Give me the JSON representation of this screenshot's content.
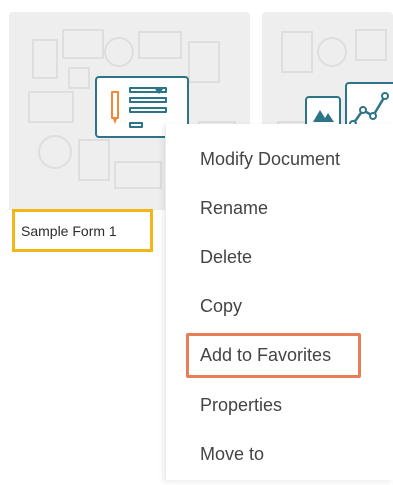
{
  "cards": [
    {
      "name": "Sample Form 1"
    }
  ],
  "context_menu": {
    "items": [
      "Modify Document",
      "Rename",
      "Delete",
      "Copy",
      "Add to Favorites",
      "Properties",
      "Move to"
    ],
    "highlighted_item": "Add to Favorites"
  },
  "colors": {
    "teal": "#2c7488",
    "orange": "#ef8a3b",
    "name_highlight": "#f2b617",
    "menu_highlight": "#e87e57"
  },
  "icons": {
    "card1": "form-document-icon",
    "card2": "chart-dashboard-icon"
  }
}
